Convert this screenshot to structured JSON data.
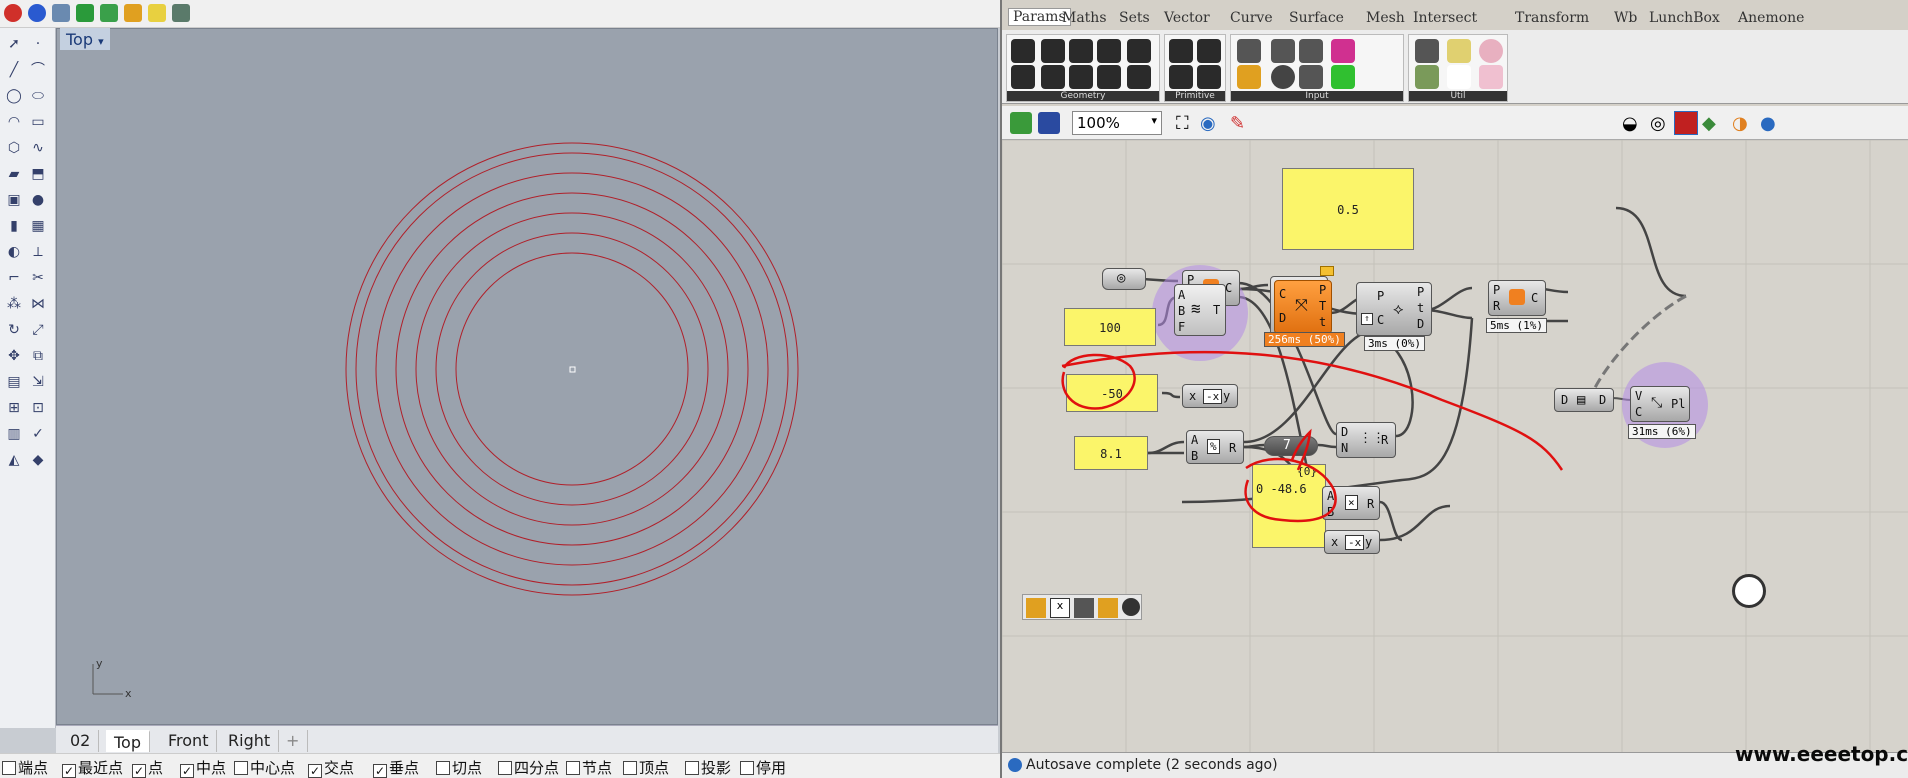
{
  "rhino": {
    "viewport_title": "Top",
    "viewport_tabs": [
      "02",
      "Top",
      "Front",
      "Right",
      "+"
    ],
    "axis_labels": {
      "y": "y",
      "x": "x"
    },
    "osnaps": [
      {
        "label": "端点",
        "checked": false
      },
      {
        "label": "最近点",
        "checked": true
      },
      {
        "label": "点",
        "checked": true
      },
      {
        "label": "中点",
        "checked": true
      },
      {
        "label": "中心点",
        "checked": false
      },
      {
        "label": "交点",
        "checked": true
      },
      {
        "label": "垂点",
        "checked": true
      },
      {
        "label": "切点",
        "checked": false
      },
      {
        "label": "四分点",
        "checked": false
      },
      {
        "label": "节点",
        "checked": false
      },
      {
        "label": "顶点",
        "checked": false
      },
      {
        "label": "投影",
        "checked": false
      },
      {
        "label": "停用",
        "checked": false
      }
    ],
    "circle_color": "#b0202a"
  },
  "grasshopper": {
    "tabs": [
      "Params",
      "Maths",
      "Sets",
      "Vector",
      "Curve",
      "Surface",
      "Mesh",
      "Intersect",
      "Transform",
      "Wb",
      "LunchBox",
      "Anemone"
    ],
    "ribbon_groups": [
      "Geometry",
      "Primitive",
      "Input",
      "Util"
    ],
    "zoom": "100%",
    "panels": {
      "p1": "0.5",
      "p2": "100",
      "p3": "-50",
      "p4": "8.1",
      "p5_header": "{0}",
      "p5_index": "0",
      "p5_value": "-48.6"
    },
    "nodes": {
      "circle": {
        "in": [
          "P",
          "R"
        ],
        "out": [
          "C"
        ]
      },
      "arc": {
        "in": [
          "C",
          "D",
          "P",
          "C"
        ],
        "out": [
          "C"
        ]
      },
      "tween": {
        "in": [
          "A",
          "B",
          "F"
        ],
        "out": [
          "T"
        ]
      },
      "eval": {
        "in": [
          "C",
          "D"
        ],
        "out": [
          "P",
          "T",
          "t"
        ]
      },
      "frame": {
        "in": [
          "P",
          "C"
        ],
        "out": [
          "P",
          "t",
          "D"
        ]
      },
      "circle2": {
        "in": [
          "P",
          "R"
        ],
        "out": [
          "C"
        ]
      },
      "neg1": {
        "in": [
          "x"
        ],
        "out": [
          "y"
        ]
      },
      "div": {
        "in": [
          "A",
          "B"
        ],
        "out": [
          "R"
        ]
      },
      "int": {
        "label": "7"
      },
      "divide": {
        "in": [
          "D",
          "N"
        ],
        "out": [
          "R"
        ]
      },
      "mult": {
        "in": [
          "A",
          "B"
        ],
        "out": [
          "R"
        ]
      },
      "neg2": {
        "in": [
          "x"
        ],
        "out": [
          "y"
        ]
      },
      "list": {
        "in": [
          "D"
        ],
        "out": [
          "D"
        ]
      },
      "plane": {
        "in": [
          "V",
          "C"
        ],
        "out": [
          "Pl"
        ]
      }
    },
    "timings": {
      "eval": "256ms (50%)",
      "frame": "3ms (0%)",
      "circle2": "5ms (1%)",
      "plane": "31ms (6%)"
    },
    "status": "Autosave complete (2 seconds ago)",
    "watermark": "www.eeeetop.com",
    "annotation_color": "#e01010"
  }
}
